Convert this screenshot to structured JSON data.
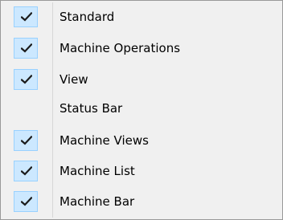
{
  "menu": {
    "items": [
      {
        "label": "Standard",
        "checked": true
      },
      {
        "label": "Machine Operations",
        "checked": true
      },
      {
        "label": "View",
        "checked": true
      },
      {
        "label": "Status Bar",
        "checked": false
      },
      {
        "label": "Machine Views",
        "checked": true
      },
      {
        "label": "Machine List",
        "checked": true
      },
      {
        "label": "Machine Bar",
        "checked": true
      }
    ],
    "colors": {
      "background": "#f0f0f0",
      "check_bg": "#cce8ff",
      "check_border": "#99d1ff",
      "check_mark": "#1b1b1b"
    },
    "check_icon": "checkmark-icon"
  }
}
